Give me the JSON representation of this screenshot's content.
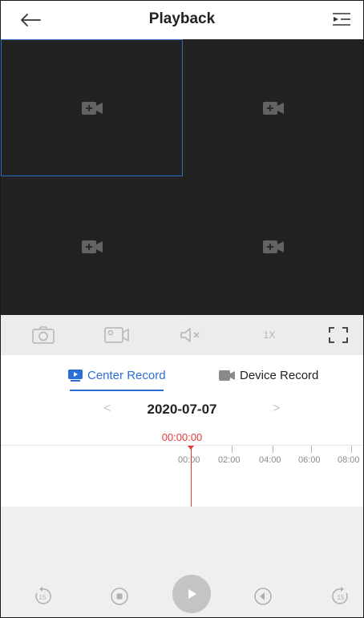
{
  "header": {
    "title": "Playback",
    "back_icon": "back-arrow-icon",
    "menu_icon": "list-menu-icon"
  },
  "grid": {
    "panes": [
      {
        "icon": "camera-icon",
        "selected": true
      },
      {
        "icon": "camera-icon",
        "selected": false
      },
      {
        "icon": "camera-icon",
        "selected": false
      },
      {
        "icon": "camera-icon",
        "selected": false
      }
    ],
    "selected_border_color": "#2f6fbf"
  },
  "controls": {
    "snapshot_icon": "camera-snapshot-icon",
    "record_icon": "video-record-icon",
    "mute_icon": "speaker-muted-icon",
    "speed_label": "1X",
    "fullscreen_icon": "fullscreen-icon"
  },
  "tabs": [
    {
      "label": "Center Record",
      "icon": "center-record-icon",
      "active": true
    },
    {
      "label": "Device Record",
      "icon": "device-record-icon",
      "active": false
    }
  ],
  "date": {
    "value": "2020-07-07",
    "prev_icon": "<",
    "next_icon": ">"
  },
  "timeline": {
    "current_time": "00:00:00",
    "labels": [
      "00:00",
      "02:00",
      "04:00",
      "06:00",
      "08:00"
    ],
    "cursor_color": "#e03a3a"
  },
  "playback": {
    "rewind_icon": "rewind-15-icon",
    "stop_icon": "stop-icon",
    "play_icon": "play-icon",
    "prev_frame_icon": "previous-frame-icon",
    "forward_icon": "forward-15-icon",
    "skip_seconds": "15"
  },
  "colors": {
    "accent": "#2c6ed8",
    "grid_bg": "#222222",
    "red": "#e03a3a"
  }
}
